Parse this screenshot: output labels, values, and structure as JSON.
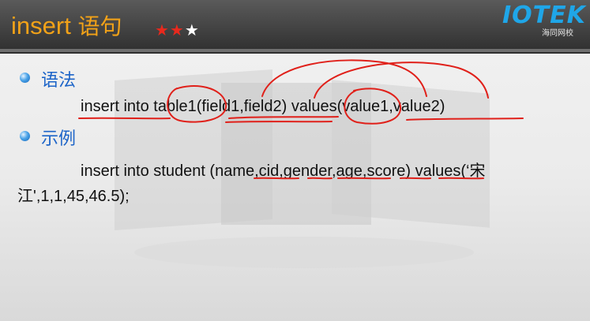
{
  "header": {
    "title": "insert",
    "title_cn": "语句",
    "stars_filled": "★★",
    "stars_empty": "★",
    "logo_text": "IOTEK",
    "logo_sub": "海同网校"
  },
  "sections": [
    {
      "heading": "语法",
      "lines": [
        "insert into table1(field1,field2) values(value1,value2)"
      ]
    },
    {
      "heading": "示例",
      "lines": [
        "insert  into student (name,cid,gender,age,score) values(‘宋",
        "江',1,1,45,46.5);"
      ]
    }
  ],
  "colors": {
    "title": "#f2a218",
    "heading": "#1c64c8",
    "annotation": "#e0201a",
    "header_bg": "#3a3a3a"
  }
}
